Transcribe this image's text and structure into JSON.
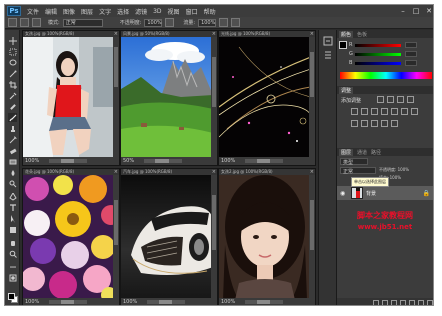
{
  "app": {
    "logo": "Ps",
    "menu": [
      "文件",
      "编辑",
      "图像",
      "图层",
      "文字",
      "选择",
      "滤镜",
      "3D",
      "视图",
      "窗口",
      "帮助"
    ],
    "window_controls": [
      "–",
      "□",
      "✕"
    ]
  },
  "options": {
    "mode": "正常",
    "opacity_label": "不透明度:",
    "opacity_value": "100%",
    "flow_label": "流量:",
    "flow_value": "100%"
  },
  "documents": [
    {
      "title": "女孩.jpg @ 100%(RGB/8)",
      "zoom": "100%",
      "image": "girl-red-top"
    },
    {
      "title": "风景.jpg @ 50%(RGB/8)",
      "zoom": "50%",
      "image": "mountain-landscape"
    },
    {
      "title": "光线.jpg @ 100%(RGB/8)",
      "zoom": "100%",
      "image": "light-trails"
    },
    {
      "title": "花朵.jpg @ 100%(RGB/8)",
      "zoom": "100%",
      "image": "flowers"
    },
    {
      "title": "汽车.jpg @ 100%(RGB/8)",
      "zoom": "100%",
      "image": "car"
    },
    {
      "title": "女孩2.jpg @ 100%(RGB/8)",
      "zoom": "100%",
      "image": "girl-portrait"
    }
  ],
  "panels": {
    "color_tabs": [
      "颜色",
      "色板"
    ],
    "color_channels": [
      "R",
      "G",
      "B"
    ],
    "adjust_tab": "调整",
    "adjust_title": "添加调整",
    "layer_tabs": [
      "图层",
      "通道",
      "路径"
    ],
    "layer_kind": "类型",
    "layer_blend": "正常",
    "layer_opacity": "不透明度: 100%",
    "layer_fill": "填充: 100%",
    "layer_name": "背景",
    "tooltip": "单击以选择此图层"
  },
  "watermark": {
    "line1": "脚本之家教程网",
    "line2": "www.jb51.net"
  },
  "colors": {
    "app_bg": "#2b2b2b",
    "panel_bg": "#3c3c3c",
    "accent_red": "#e8102a"
  }
}
